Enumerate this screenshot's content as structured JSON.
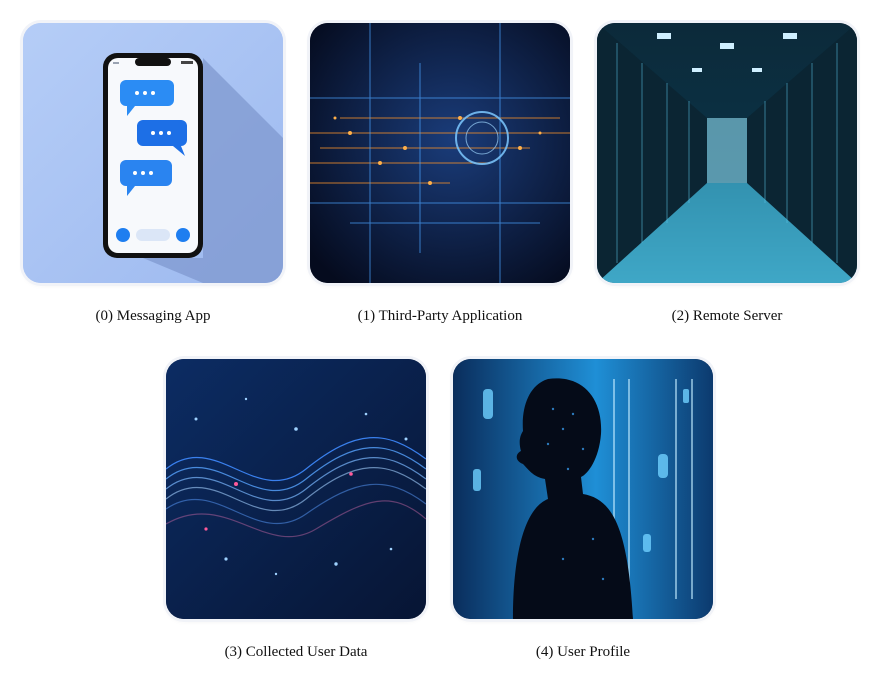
{
  "items": [
    {
      "caption": "(0) Messaging App",
      "image": "smartphone-chat-icon"
    },
    {
      "caption": "(1) Third-Party Application",
      "image": "circuit-board-icon"
    },
    {
      "caption": "(2) Remote Server",
      "image": "server-room-icon"
    },
    {
      "caption": "(3) Collected User Data",
      "image": "data-wave-icon"
    },
    {
      "caption": "(4) User Profile",
      "image": "digital-person-silhouette-icon"
    }
  ]
}
